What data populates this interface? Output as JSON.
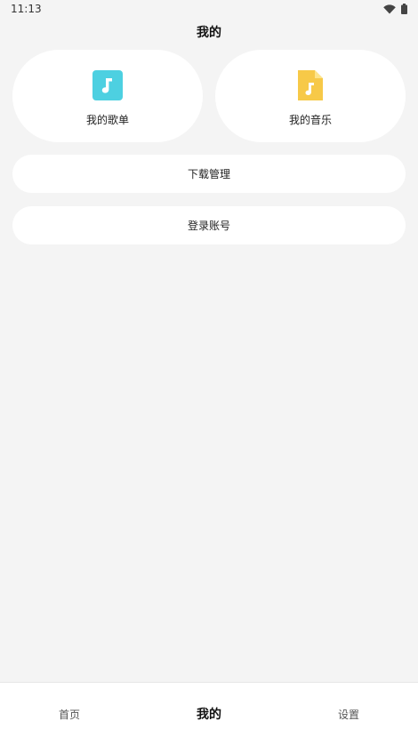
{
  "status_bar": {
    "time": "11:13",
    "icons": [
      "wifi-icon",
      "battery-icon"
    ]
  },
  "header": {
    "title": "我的"
  },
  "cards": [
    {
      "label": "我的歌单",
      "icon": "music-note-icon",
      "color": "#4dd0e1"
    },
    {
      "label": "我的音乐",
      "icon": "music-file-icon",
      "color": "#f7c948"
    }
  ],
  "menu": {
    "download_label": "下载管理",
    "login_label": "登录账号"
  },
  "bottom_nav": {
    "items": [
      {
        "label": "首页",
        "active": false
      },
      {
        "label": "我的",
        "active": true
      },
      {
        "label": "设置",
        "active": false
      }
    ]
  }
}
